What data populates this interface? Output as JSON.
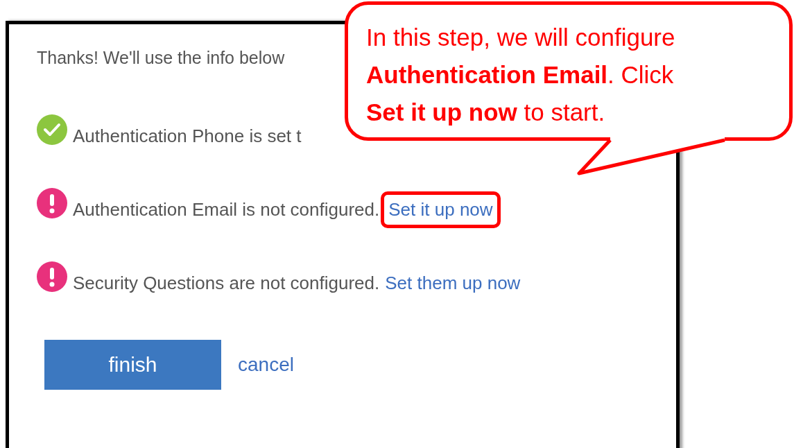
{
  "intro": "Thanks! We'll use the info below",
  "items": [
    {
      "kind": "ok",
      "text": "Authentication Phone is set t"
    },
    {
      "kind": "missing",
      "text": "Authentication Email is not configured.",
      "link": "Set it up now",
      "highlighted": true
    },
    {
      "kind": "missing",
      "text": "Security Questions are not configured.",
      "link": "Set them up now",
      "highlighted": false
    }
  ],
  "buttons": {
    "primary": "finish",
    "secondary": "cancel"
  },
  "callout": {
    "text": "In this step, we will configure **Authentication Email**.  Click **Set it up now** to start."
  }
}
